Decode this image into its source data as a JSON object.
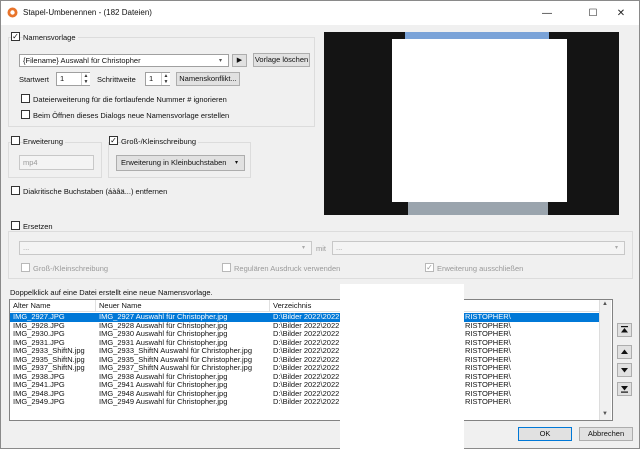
{
  "window": {
    "title": "Stapel-Umbenennen - (182 Dateien)",
    "minimize": "—",
    "maximize": "☐",
    "close": "✕"
  },
  "naming": {
    "checkbox_checked": true,
    "label": "Namensvorlage",
    "template_value": "{Filename} Auswahl für Christopher",
    "play_button": "▶",
    "delete_button": "Vorlage löschen",
    "start_label": "Startwert",
    "start_value": "1",
    "step_label": "Schrittweite",
    "step_value": "1",
    "conflict_button": "Namenskonflikt...",
    "ignore_ext_label": "Dateierweiterung für die fortlaufende Nummer # ignorieren",
    "new_template_label": "Beim Öffnen dieses Dialogs neue Namensvorlage erstellen"
  },
  "extension": {
    "label": "Erweiterung",
    "value": "mp4"
  },
  "case": {
    "label": "Groß-/Kleinschreibung",
    "checked": true,
    "option": "Erweiterung in Kleinbuchstaben"
  },
  "diacritics": {
    "label": "Diakritische Buchstaben (áàâä...) entfernen"
  },
  "replace": {
    "label": "Ersetzen",
    "from_value": "...",
    "with_label": "mit",
    "to_value": "...",
    "case_label": "Groß-/Kleinschreibung",
    "regex_label": "Regulären Ausdruck verwenden",
    "exclude_ext_label": "Erweiterung ausschließen"
  },
  "hint": "Doppelklick auf eine Datei erstellt eine neue Namensvorlage.",
  "columns": [
    "Alter Name",
    "Neuer Name",
    "Verzeichnis"
  ],
  "rows": [
    {
      "old": "IMG_2927.JPG",
      "new": "IMG_2927 Auswahl für Christopher.jpg",
      "dir": "D:\\Bilder 2022\\2022",
      "tail": "RISTOPHER\\",
      "selected": true
    },
    {
      "old": "IMG_2928.JPG",
      "new": "IMG_2928 Auswahl für Christopher.jpg",
      "dir": "D:\\Bilder 2022\\2022",
      "tail": "RISTOPHER\\"
    },
    {
      "old": "IMG_2930.JPG",
      "new": "IMG_2930 Auswahl für Christopher.jpg",
      "dir": "D:\\Bilder 2022\\2022",
      "tail": "RISTOPHER\\"
    },
    {
      "old": "IMG_2931.JPG",
      "new": "IMG_2931 Auswahl für Christopher.jpg",
      "dir": "D:\\Bilder 2022\\2022",
      "tail": "RISTOPHER\\"
    },
    {
      "old": "IMG_2933_ShiftN.jpg",
      "new": "IMG_2933_ShiftN Auswahl für Christopher.jpg",
      "dir": "D:\\Bilder 2022\\2022",
      "tail": "RISTOPHER\\"
    },
    {
      "old": "IMG_2935_ShiftN.jpg",
      "new": "IMG_2935_ShiftN Auswahl für Christopher.jpg",
      "dir": "D:\\Bilder 2022\\2022",
      "tail": "RISTOPHER\\"
    },
    {
      "old": "IMG_2937_ShiftN.jpg",
      "new": "IMG_2937_ShiftN Auswahl für Christopher.jpg",
      "dir": "D:\\Bilder 2022\\2022",
      "tail": "RISTOPHER\\"
    },
    {
      "old": "IMG_2938.JPG",
      "new": "IMG_2938 Auswahl für Christopher.jpg",
      "dir": "D:\\Bilder 2022\\2022",
      "tail": "RISTOPHER\\"
    },
    {
      "old": "IMG_2941.JPG",
      "new": "IMG_2941 Auswahl für Christopher.jpg",
      "dir": "D:\\Bilder 2022\\2022",
      "tail": "RISTOPHER\\"
    },
    {
      "old": "IMG_2948.JPG",
      "new": "IMG_2948 Auswahl für Christopher.jpg",
      "dir": "D:\\Bilder 2022\\2022",
      "tail": "RISTOPHER\\"
    },
    {
      "old": "IMG_2949.JPG",
      "new": "IMG_2949 Auswahl für Christopher.jpg",
      "dir": "D:\\Bilder 2022\\2022",
      "tail": "RISTOPHER\\"
    }
  ],
  "buttons": {
    "ok": "OK",
    "cancel": "Abbrechen"
  },
  "nav": {
    "top": "⏶",
    "up": "▲",
    "down": "▼",
    "bottom": "⏷"
  },
  "colors": {
    "selection": "#0078d7",
    "preview_bg": "#141414"
  }
}
